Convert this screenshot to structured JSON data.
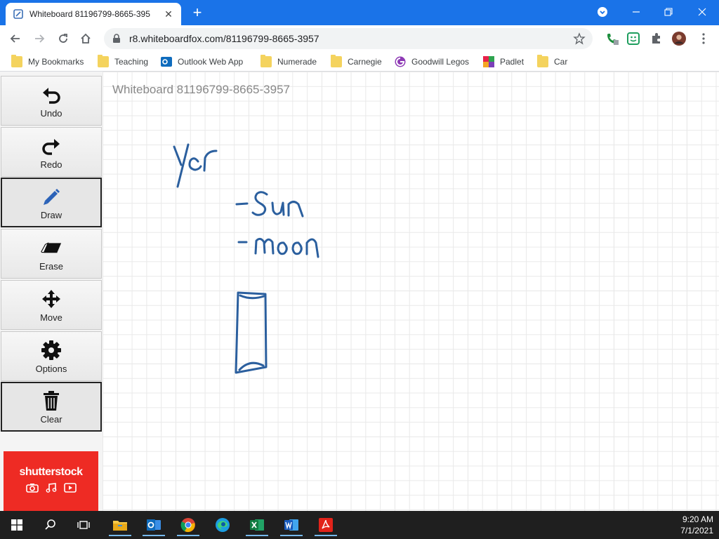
{
  "browser": {
    "tab_title": "Whiteboard 81196799-8665-395",
    "url": "r8.whiteboardfox.com/81196799-8665-3957",
    "bookmarks": [
      {
        "label": "My Bookmarks",
        "icon": "folder-icon"
      },
      {
        "label": "Teaching",
        "icon": "folder-icon"
      },
      {
        "label": "Outlook Web App",
        "icon": "outlook-icon"
      },
      {
        "label": "Numerade",
        "icon": "folder-icon"
      },
      {
        "label": "Carnegie",
        "icon": "folder-icon"
      },
      {
        "label": "Goodwill Legos",
        "icon": "goodwill-icon"
      },
      {
        "label": "Padlet",
        "icon": "padlet-icon"
      },
      {
        "label": "Car",
        "icon": "folder-icon"
      }
    ]
  },
  "whiteboard": {
    "title": "Whiteboard 81196799-8665-3957",
    "ink_color": "#2b5f9e",
    "handwriting": [
      "yer",
      "-Sun",
      "-moon"
    ]
  },
  "tools": [
    {
      "label": "Undo",
      "icon": "undo-icon"
    },
    {
      "label": "Redo",
      "icon": "redo-icon"
    },
    {
      "label": "Draw",
      "icon": "pencil-icon",
      "active": true
    },
    {
      "label": "Erase",
      "icon": "eraser-icon"
    },
    {
      "label": "Move",
      "icon": "move-icon"
    },
    {
      "label": "Options",
      "icon": "gear-icon"
    },
    {
      "label": "Clear",
      "icon": "trash-icon"
    }
  ],
  "ad": {
    "brand": "shutterstock"
  },
  "taskbar": {
    "time": "9:20 AM",
    "date": "7/1/2021"
  }
}
